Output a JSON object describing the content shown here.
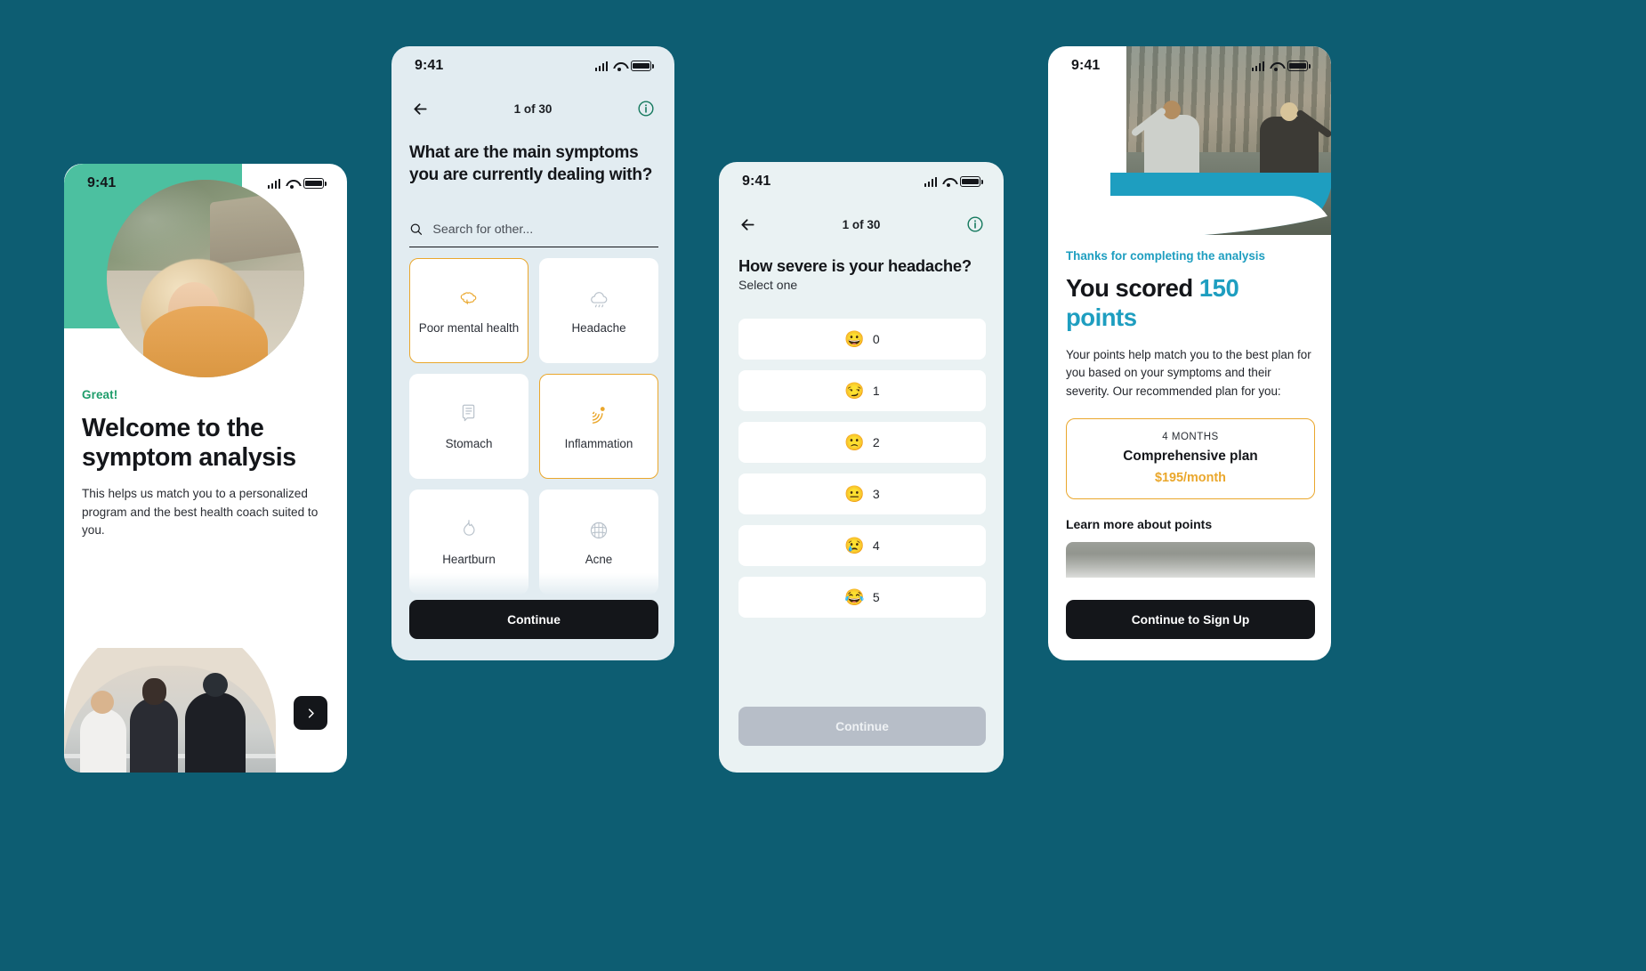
{
  "colors": {
    "page_background": "#0d5d72",
    "accent_teal": "#1e9ec0",
    "accent_green": "#1f9d6b",
    "accent_amber": "#eaa72c",
    "dark_button": "#14161a",
    "disabled_button": "#b7bec8",
    "screen2_background": "#e2ecf1",
    "screen3_background": "#eaf2f3",
    "blob_green": "#4cc0a0"
  },
  "status_bar": {
    "time": "9:41",
    "signal_icon": "cellular-signal-icon",
    "wifi_icon": "wifi-icon",
    "battery_icon": "battery-icon"
  },
  "screen1": {
    "name": "welcome-screen",
    "eyebrow": "Great!",
    "title": "Welcome to the symptom analysis",
    "body": "This helps us match you to a personalized program and the best health coach suited to you.",
    "next_icon": "chevron-right-icon",
    "hero_image_alt": "smiling-woman-outdoors-photo",
    "bottom_image_alt": "three-people-sitting-overlook-photo"
  },
  "screen2": {
    "name": "symptom-selection-screen",
    "back_icon": "arrow-left-icon",
    "progress": "1 of 30",
    "info_icon": "info-circle-icon",
    "question": "What are the main symptoms you are currently dealing with?",
    "search": {
      "placeholder": "Search for other...",
      "value": "",
      "icon": "search-icon"
    },
    "symptoms": [
      {
        "label": "Poor mental health",
        "icon": "brain-icon",
        "selected": true
      },
      {
        "label": "Headache",
        "icon": "cloud-icon",
        "selected": false
      },
      {
        "label": "Stomach",
        "icon": "stomach-icon",
        "selected": false
      },
      {
        "label": "Inflammation",
        "icon": "inflammation-icon",
        "selected": true
      },
      {
        "label": "Heartburn",
        "icon": "flame-icon",
        "selected": false
      },
      {
        "label": "Acne",
        "icon": "acne-icon",
        "selected": false
      }
    ],
    "continue_label": "Continue"
  },
  "screen3": {
    "name": "severity-rating-screen",
    "back_icon": "arrow-left-icon",
    "progress": "1 of 30",
    "info_icon": "info-circle-icon",
    "question": "How severe is your headache?",
    "subtitle": "Select one",
    "options": [
      {
        "emoji": "😀",
        "value": "0"
      },
      {
        "emoji": "😏",
        "value": "1"
      },
      {
        "emoji": "🙁",
        "value": "2"
      },
      {
        "emoji": "😐",
        "value": "3"
      },
      {
        "emoji": "😢",
        "value": "4"
      },
      {
        "emoji": "😂",
        "value": "5"
      }
    ],
    "continue_label": "Continue",
    "continue_disabled": true
  },
  "screen4": {
    "name": "results-screen",
    "hero_image_alt": "two-women-arms-raised-by-lake-photo",
    "thanks": "Thanks for completing the analysis",
    "score_prefix": "You scored ",
    "score_value": "150",
    "score_suffix": " points",
    "description": "Your points help match you to the best plan for you based on your symptoms and their severity. Our recommended plan for you:",
    "plan": {
      "duration": "4 MONTHS",
      "name": "Comprehensive plan",
      "price": "$195/month"
    },
    "learn_more": "Learn more about points",
    "cta_label": "Continue to Sign Up"
  }
}
